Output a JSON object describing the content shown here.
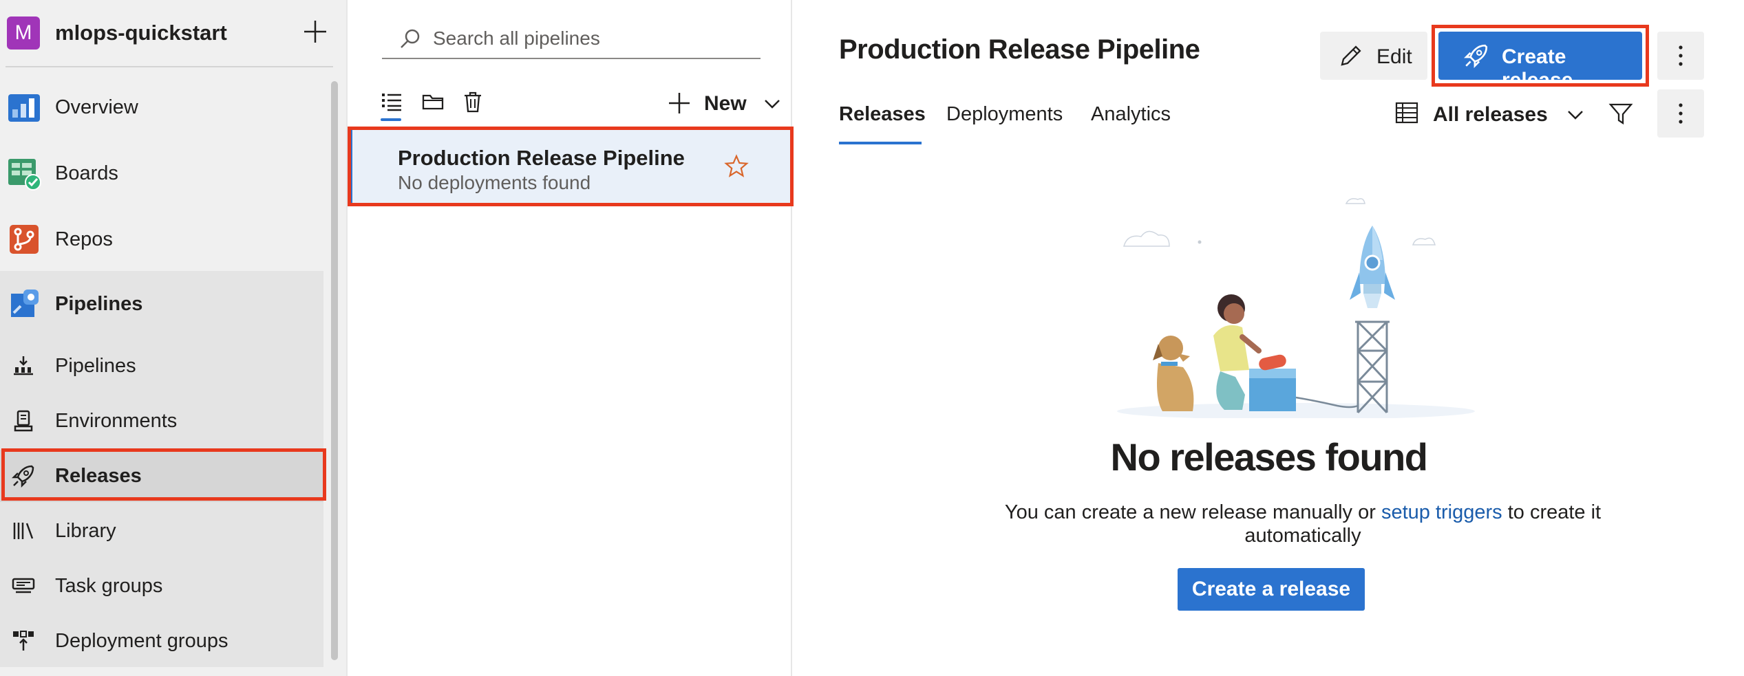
{
  "project": {
    "avatar_letter": "M",
    "name": "mlops-quickstart",
    "avatar_color": "#a035b8"
  },
  "nav": {
    "items": [
      {
        "label": "Overview",
        "icon": "overview-icon"
      },
      {
        "label": "Boards",
        "icon": "boards-icon"
      },
      {
        "label": "Repos",
        "icon": "repos-icon"
      },
      {
        "label": "Pipelines",
        "icon": "pipelines-icon"
      }
    ],
    "sub_items": [
      {
        "label": "Pipelines",
        "icon": "pipelines-list-icon"
      },
      {
        "label": "Environments",
        "icon": "environments-icon"
      },
      {
        "label": "Releases",
        "icon": "rocket-icon",
        "selected": true
      },
      {
        "label": "Library",
        "icon": "library-icon"
      },
      {
        "label": "Task groups",
        "icon": "task-groups-icon"
      },
      {
        "label": "Deployment groups",
        "icon": "deployment-groups-icon"
      }
    ]
  },
  "pipelines_panel": {
    "search_placeholder": "Search all pipelines",
    "new_label": "New",
    "pipeline": {
      "title": "Production Release Pipeline",
      "subtitle": "No deployments found"
    }
  },
  "main": {
    "title": "Production Release Pipeline",
    "edit_label": "Edit",
    "create_release_label": "Create release",
    "tabs": [
      "Releases",
      "Deployments",
      "Analytics"
    ],
    "active_tab": "Releases",
    "view_selector": "All releases",
    "empty": {
      "title": "No releases found",
      "desc_before": "You can create a new release manually or ",
      "desc_link": "setup triggers",
      "desc_after": " to create it automatically",
      "button_label": "Create a release"
    }
  },
  "colors": {
    "accent": "#2b73cf",
    "highlight": "#e8391d",
    "link": "#1a5cab",
    "star": "#d9662b"
  }
}
